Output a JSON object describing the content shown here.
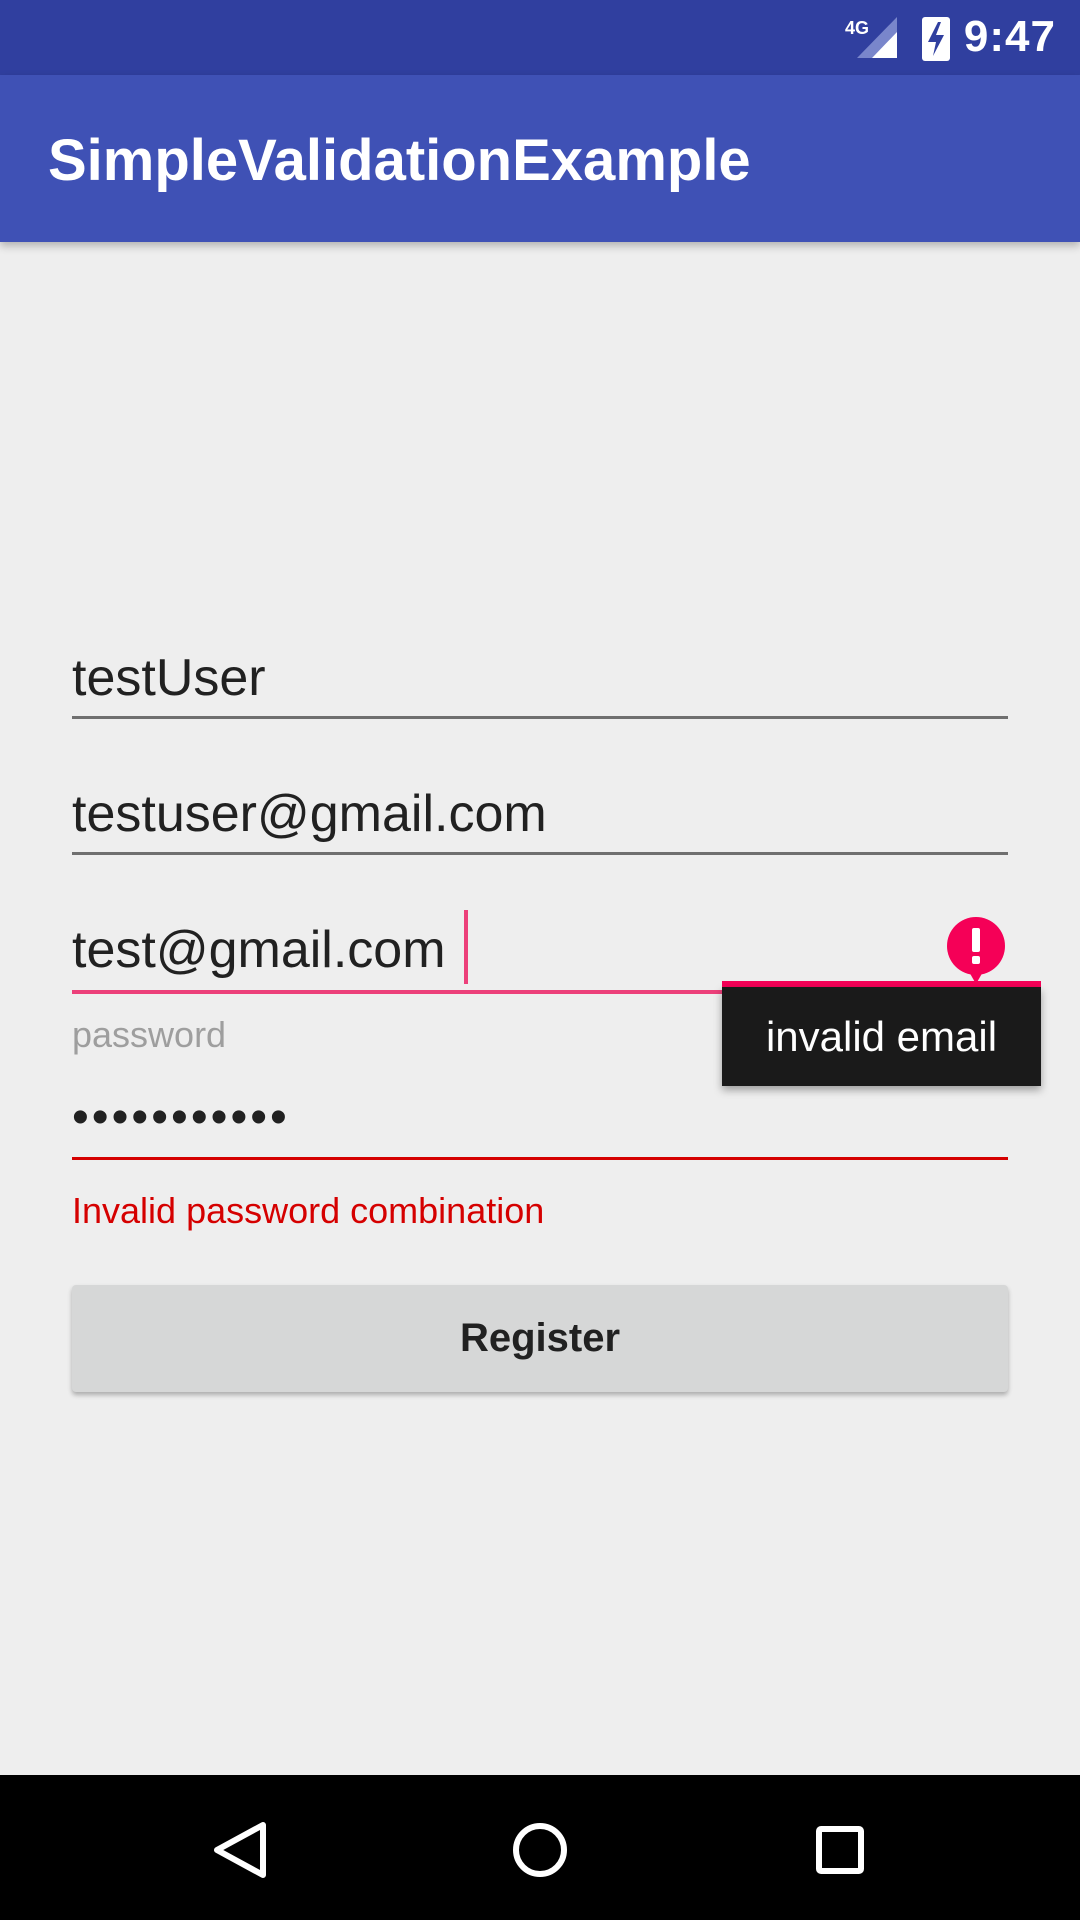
{
  "status_bar": {
    "network": "4G",
    "time": "9:47",
    "icons": [
      "signal-icon",
      "battery-charging-icon"
    ]
  },
  "app_bar": {
    "title": "SimpleValidationExample"
  },
  "form": {
    "username": {
      "value": "testUser"
    },
    "email": {
      "value": "testuser@gmail.com"
    },
    "confirm_email": {
      "value": "test@gmail.com",
      "error_popup": "invalid email"
    },
    "password": {
      "label": "password",
      "masked_value": "•••••••••••",
      "error": "Invalid password combination"
    },
    "register_label": "Register"
  },
  "colors": {
    "status_bar": "#303f9f",
    "app_bar": "#3f51b5",
    "accent": "#ec407a",
    "error": "#d50000"
  },
  "nav_bar": {
    "icons": [
      "back-icon",
      "home-icon",
      "recents-icon"
    ]
  }
}
